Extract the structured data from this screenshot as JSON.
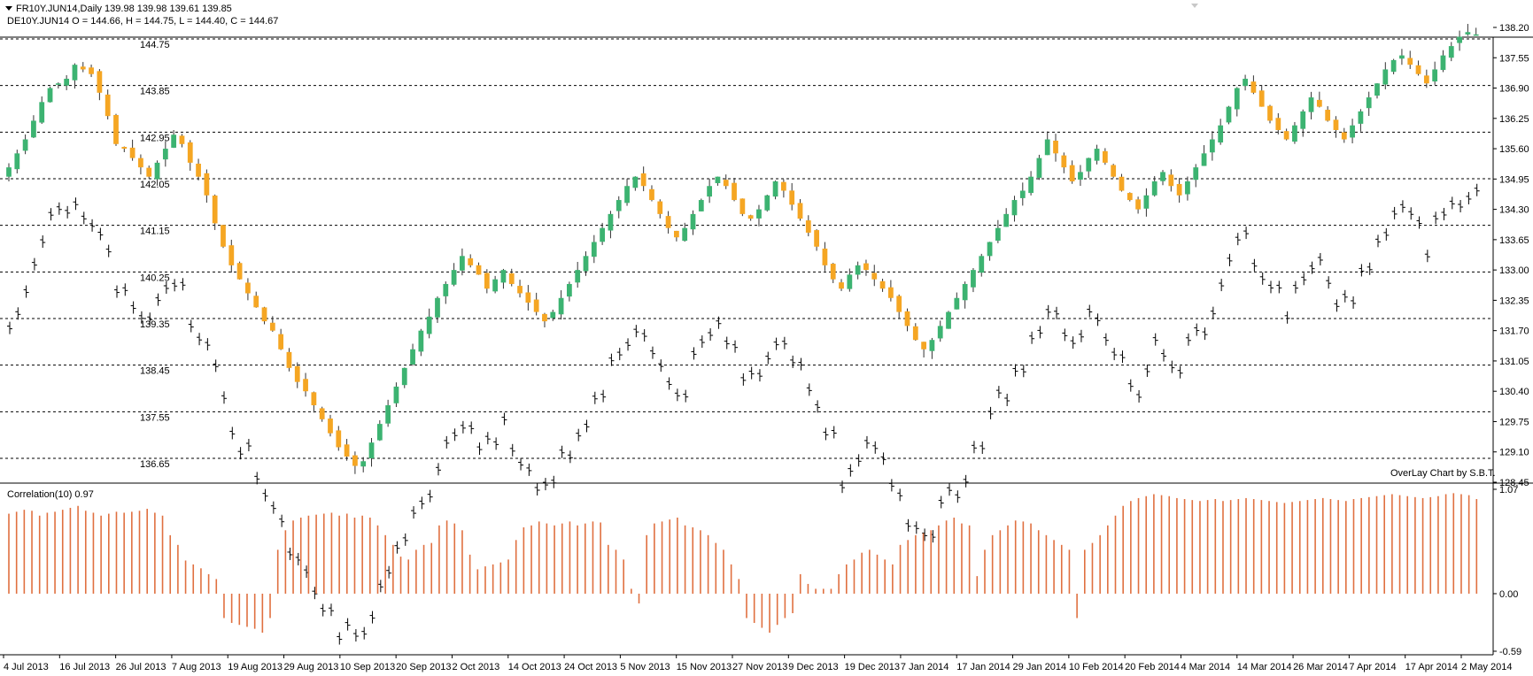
{
  "header": {
    "title": "FR10Y.JUN14,Daily  139.98 139.98 139.61 139.85",
    "overlay": "DE10Y.JUN14 O = 144.66, H = 144.75, L = 144.40, C = 144.67",
    "correlation_label": "Correlation(10) 0.97",
    "credit": "OverLay Chart by S.B.T."
  },
  "colors": {
    "up": "#3cb371",
    "down": "#f5a623",
    "overlay_bars": "#000000",
    "correlation": "#e07040",
    "grid": "#000000"
  },
  "chart_data": [
    {
      "type": "candlestick",
      "name": "FR10Y.JUN14",
      "ylabel_ticks": [
        "138.20",
        "137.55",
        "136.90",
        "136.25",
        "135.60",
        "134.95",
        "134.30",
        "133.65",
        "133.00",
        "132.35",
        "131.70",
        "131.05",
        "130.40",
        "129.75",
        "129.10",
        "128.45"
      ],
      "ylim": [
        128.45,
        138.2
      ],
      "x_ticks": [
        "4 Jul 2013",
        "16 Jul 2013",
        "26 Jul 2013",
        "7 Aug 2013",
        "19 Aug 2013",
        "29 Aug 2013",
        "10 Sep 2013",
        "20 Sep 2013",
        "2 Oct 2013",
        "14 Oct 2013",
        "24 Oct 2013",
        "5 Nov 2013",
        "15 Nov 2013",
        "27 Nov 2013",
        "9 Dec 2013",
        "19 Dec 2013",
        "7 Jan 2014",
        "17 Jan 2014",
        "29 Jan 2014",
        "10 Feb 2014",
        "20 Feb 2014",
        "4 Mar 2014",
        "14 Mar 2014",
        "26 Mar 2014",
        "7 Apr 2014",
        "17 Apr 2014",
        "2 May 2014"
      ],
      "closes": [
        135.2,
        135.5,
        135.8,
        136.2,
        136.6,
        136.9,
        137.0,
        137.1,
        137.4,
        137.3,
        137.2,
        136.8,
        136.3,
        135.7,
        135.6,
        135.4,
        135.2,
        135.0,
        135.3,
        135.6,
        135.9,
        135.7,
        135.3,
        135.0,
        134.6,
        134.0,
        133.5,
        133.1,
        132.8,
        132.5,
        132.2,
        131.9,
        131.7,
        131.3,
        130.9,
        130.6,
        130.4,
        130.1,
        129.8,
        129.5,
        129.2,
        129.0,
        128.8,
        128.9,
        129.3,
        129.7,
        130.1,
        130.5,
        130.9,
        131.3,
        131.7,
        132.0,
        132.4,
        132.7,
        133.0,
        133.3,
        133.1,
        132.9,
        132.6,
        132.8,
        133.0,
        132.7,
        132.5,
        132.3,
        132.1,
        131.9,
        132.1,
        132.4,
        132.7,
        133.0,
        133.3,
        133.6,
        133.9,
        134.2,
        134.5,
        134.8,
        135.0,
        134.8,
        134.5,
        134.2,
        133.9,
        133.7,
        133.9,
        134.2,
        134.5,
        134.8,
        135.0,
        134.8,
        134.5,
        134.2,
        134.1,
        134.3,
        134.6,
        134.9,
        134.7,
        134.4,
        134.1,
        133.8,
        133.5,
        133.1,
        132.8,
        132.6,
        132.9,
        133.1,
        133.0,
        132.8,
        132.6,
        132.4,
        132.1,
        131.8,
        131.5,
        131.3,
        131.5,
        131.8,
        132.1,
        132.4,
        132.7,
        133.0,
        133.3,
        133.6,
        133.9,
        134.2,
        134.5,
        134.7,
        135.0,
        135.4,
        135.8,
        135.5,
        135.2,
        134.9,
        135.1,
        135.4,
        135.6,
        135.3,
        135.0,
        134.7,
        134.5,
        134.3,
        134.6,
        134.9,
        135.1,
        134.8,
        134.6,
        134.9,
        135.2,
        135.5,
        135.8,
        136.1,
        136.5,
        136.9,
        137.1,
        136.8,
        136.5,
        136.2,
        136.0,
        135.8,
        136.1,
        136.4,
        136.7,
        136.5,
        136.2,
        136.0,
        135.8,
        136.1,
        136.4,
        136.7,
        137.0,
        137.3,
        137.5,
        137.6,
        137.4,
        137.2,
        137.0,
        137.3,
        137.6,
        137.8,
        138.0,
        138.1,
        138.05
      ],
      "overlay_series": {
        "name": "DE10Y.JUN14",
        "ylabel_ticks": [
          "144.75",
          "143.85",
          "142.95",
          "142.05",
          "141.15",
          "140.25",
          "139.35",
          "138.45",
          "137.55",
          "136.65"
        ],
        "ylim": [
          136.65,
          144.75
        ]
      }
    },
    {
      "type": "bar",
      "name": "Correlation(10)",
      "ylabel_ticks": [
        "1.07",
        "0.00",
        "-0.59"
      ],
      "ylim": [
        -0.59,
        1.07
      ],
      "values": [
        0.82,
        0.84,
        0.86,
        0.85,
        0.8,
        0.83,
        0.84,
        0.86,
        0.88,
        0.9,
        0.85,
        0.83,
        0.8,
        0.82,
        0.84,
        0.83,
        0.84,
        0.85,
        0.87,
        0.83,
        0.8,
        0.6,
        0.5,
        0.34,
        0.3,
        0.26,
        0.2,
        0.15,
        -0.25,
        -0.3,
        -0.32,
        -0.34,
        -0.36,
        -0.4,
        -0.25,
        0.45,
        0.65,
        0.75,
        0.78,
        0.8,
        0.81,
        0.82,
        0.83,
        0.8,
        0.82,
        0.78,
        0.8,
        0.78,
        0.7,
        0.6,
        0.5,
        0.38,
        0.35,
        0.45,
        0.5,
        0.52,
        0.7,
        0.75,
        0.72,
        0.65,
        0.4,
        0.25,
        0.28,
        0.3,
        0.32,
        0.35,
        0.55,
        0.68,
        0.7,
        0.74,
        0.72,
        0.7,
        0.72,
        0.74,
        0.7,
        0.72,
        0.74,
        0.73,
        0.5,
        0.45,
        0.35,
        0.05,
        -0.1,
        0.6,
        0.72,
        0.74,
        0.76,
        0.78,
        0.7,
        0.68,
        0.65,
        0.6,
        0.52,
        0.45,
        0.3,
        0.15,
        -0.25,
        -0.3,
        -0.35,
        -0.4,
        -0.32,
        -0.25,
        -0.2,
        0.2,
        0.1,
        0.05,
        0.05,
        0.05,
        0.2,
        0.3,
        0.35,
        0.42,
        0.45,
        0.4,
        0.35,
        0.3,
        0.5,
        0.55,
        0.6,
        0.62,
        0.65,
        0.7,
        0.75,
        0.78,
        0.72,
        0.7,
        0.18,
        0.45,
        0.6,
        0.65,
        0.7,
        0.75,
        0.74,
        0.72,
        0.65,
        0.6,
        0.55,
        0.5,
        0.45,
        -0.25,
        0.45,
        0.52,
        0.6,
        0.7,
        0.8,
        0.9,
        0.95,
        0.98,
        1.0,
        1.02,
        1.01,
        1.0,
        0.98,
        0.97,
        0.96,
        0.95,
        0.96,
        0.97,
        0.95,
        0.96,
        0.97,
        0.98,
        0.97,
        0.96,
        0.95,
        0.94,
        0.93,
        0.94,
        0.95,
        0.96,
        0.97,
        0.98,
        0.97,
        0.96,
        0.95,
        0.97,
        0.98,
        0.99,
        1.0,
        1.01,
        1.02,
        1.01,
        1.0,
        0.99,
        0.98,
        0.99,
        1.0,
        1.02,
        1.03,
        1.02,
        1.01,
        0.97
      ]
    }
  ]
}
